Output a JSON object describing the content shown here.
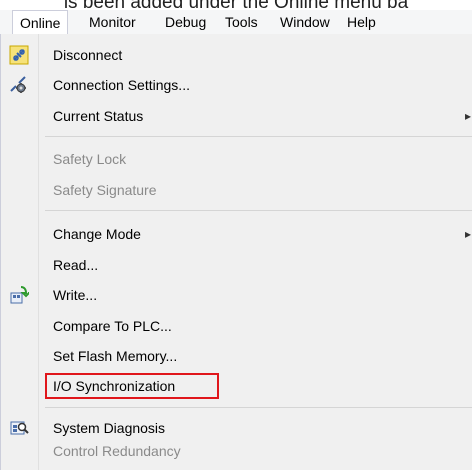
{
  "caption": "ls been added under the Online menu ba",
  "menubar": {
    "items": [
      {
        "label": "Online"
      },
      {
        "label": "Monitor"
      },
      {
        "label": "Debug"
      },
      {
        "label": "Tools"
      },
      {
        "label": "Window"
      },
      {
        "label": "Help"
      }
    ]
  },
  "menu": {
    "items": [
      {
        "label": "Disconnect",
        "icon": "disconnect-plug-icon",
        "enabled": true
      },
      {
        "label": "Connection Settings...",
        "icon": "connection-settings-gear-icon",
        "enabled": true
      },
      {
        "label": "Current Status",
        "enabled": true,
        "submenu": true
      },
      {
        "label": "Safety Lock",
        "enabled": false
      },
      {
        "label": "Safety Signature",
        "enabled": false
      },
      {
        "label": "Change Mode",
        "enabled": true,
        "submenu": true
      },
      {
        "label": "Read...",
        "enabled": true
      },
      {
        "label": "Write...",
        "icon": "write-plc-icon",
        "enabled": true
      },
      {
        "label": "Compare To PLC...",
        "enabled": true
      },
      {
        "label": "Set Flash Memory...",
        "enabled": true
      },
      {
        "label": "I/O Synchronization",
        "enabled": true,
        "highlighted": true
      },
      {
        "label": "System Diagnosis",
        "icon": "system-diagnosis-icon",
        "enabled": true
      },
      {
        "label": "Control Redundancy",
        "enabled": false
      }
    ]
  },
  "colors": {
    "highlight_border": "#e0161b",
    "disabled_text": "#8a8a8a"
  }
}
